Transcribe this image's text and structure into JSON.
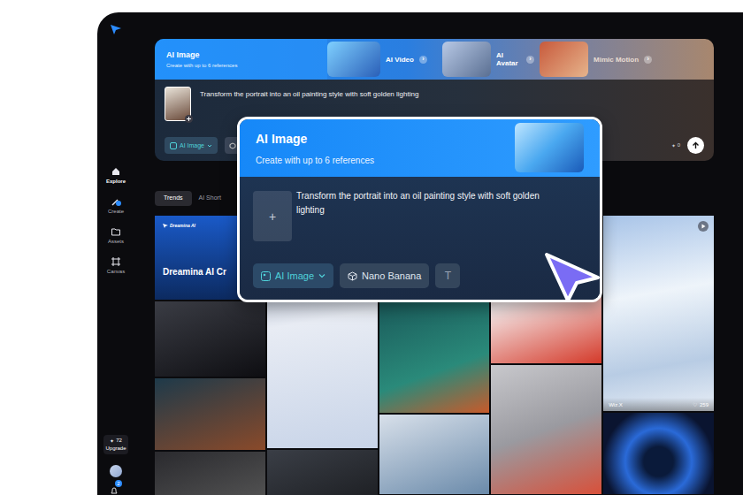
{
  "sidebar": {
    "items": [
      {
        "label": "Explore",
        "selected": true
      },
      {
        "label": "Create",
        "selected": false
      },
      {
        "label": "Assets",
        "selected": false
      },
      {
        "label": "Canvas",
        "selected": false
      }
    ],
    "credits": {
      "icon": "✦",
      "count": "72",
      "action": "Upgrade"
    },
    "notifications": "2"
  },
  "feature_tabs": [
    {
      "title": "AI Image",
      "subtitle": "Create with up to 6 references",
      "selected": true
    },
    {
      "title": "AI Video",
      "arrow": "›",
      "selected": false
    },
    {
      "title": "AI Avatar",
      "arrow": "›",
      "selected": false
    },
    {
      "title": "Mimic Motion",
      "arrow": "›",
      "selected": false
    }
  ],
  "prompt": {
    "text": "Transform the portrait into an oil painting style with soft golden lighting",
    "mode": "AI Image",
    "credits_icon": "✦",
    "credits": "0"
  },
  "content_tabs": [
    {
      "label": "Trends",
      "selected": true
    },
    {
      "label": "AI Short",
      "selected": false
    }
  ],
  "gallery": {
    "banner": {
      "brand": "Dreamina AI",
      "title": "Dreamina AI Cr"
    },
    "featured": {
      "author": "Wiz.X",
      "likes_icon": "♡",
      "likes": "259"
    }
  },
  "popup": {
    "title": "AI Image",
    "subtitle": "Create with up to 6 references",
    "add": "+",
    "prompt": "Transform the portrait into an oil painting style with soft golden lighting",
    "mode": "AI Image",
    "model": "Nano Banana",
    "text_tool": "T"
  }
}
